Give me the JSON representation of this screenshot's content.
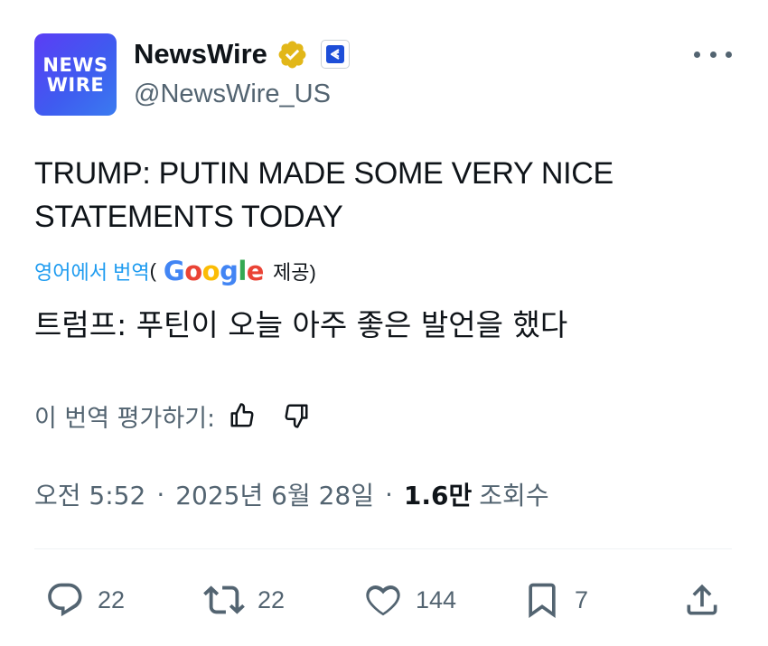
{
  "account": {
    "avatar_line1": "NEWS",
    "avatar_line2": "WIRE",
    "display_name": "NewsWire",
    "handle": "@NewsWire_US",
    "verified_badge_color": "#E2B719",
    "affiliate_badge_color": "#1d4ed8"
  },
  "more_menu_icon": "more-horizontal-icon",
  "tweet": {
    "text": "TRUMP: PUTIN MADE SOME VERY NICE STATEMENTS TODAY"
  },
  "translation": {
    "source_label": "영어에서 번역",
    "paren_open": "(",
    "provider_name": "Google",
    "provider_suffix": "제공)",
    "text": "트럼프: 푸틴이 오늘 아주 좋은 발언을 했다",
    "rate_prompt": "이 번역 평가하기:"
  },
  "meta": {
    "time": "오전 5:52",
    "separator": "·",
    "date": "2025년 6월 28일",
    "views_count": "1.6만",
    "views_label": "조회수"
  },
  "actions": {
    "replies": "22",
    "reposts": "22",
    "likes": "144",
    "bookmarks": "7"
  },
  "colors": {
    "text_primary": "#0f1419",
    "text_secondary": "#536471",
    "link_blue": "#1d9bf0",
    "google_blue": "#4285F4",
    "google_red": "#EA4335",
    "google_yellow": "#FBBC05",
    "google_green": "#34A853"
  }
}
